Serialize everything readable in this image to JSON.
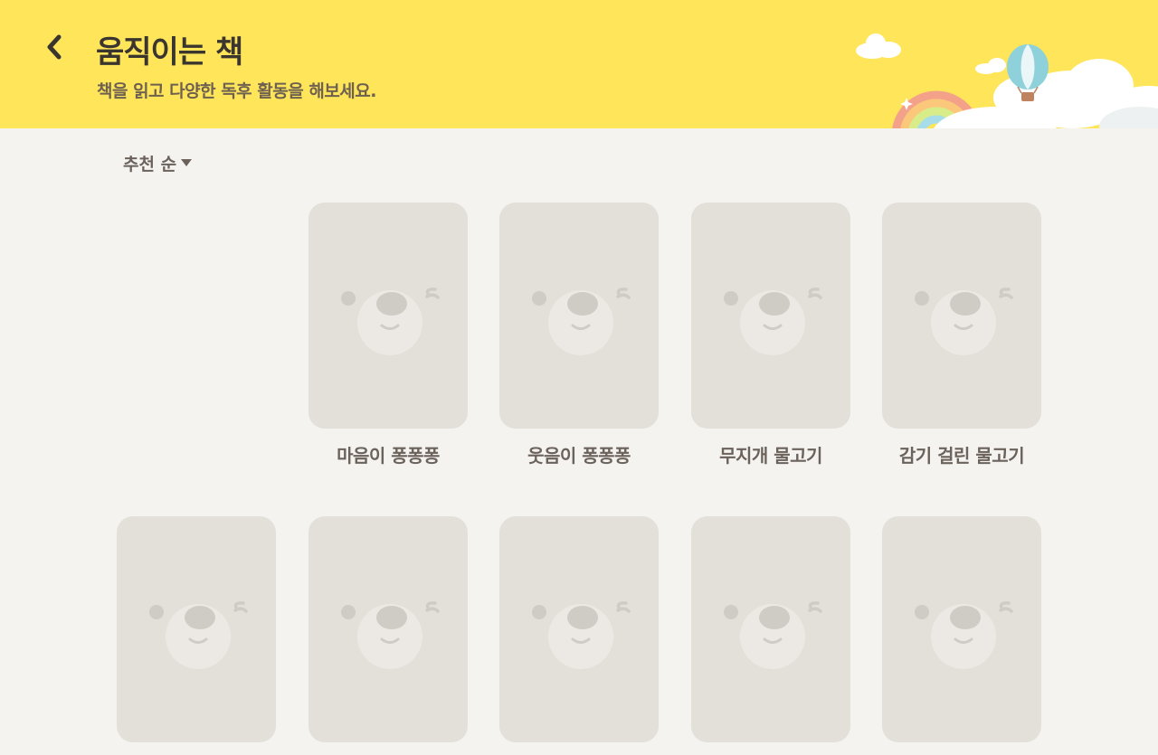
{
  "header": {
    "title": "움직이는 책",
    "subtitle": "책을 읽고 다양한 독후 활동을 해보세요."
  },
  "sort": {
    "label": "추천 순"
  },
  "books": [
    {
      "title": "마음이 퐁퐁퐁"
    },
    {
      "title": "웃음이 퐁퐁퐁"
    },
    {
      "title": "무지개 물고기"
    },
    {
      "title": "감기 걸린 물고기"
    },
    {
      "title": ""
    },
    {
      "title": ""
    },
    {
      "title": ""
    },
    {
      "title": ""
    },
    {
      "title": ""
    }
  ],
  "colors": {
    "header_bg": "#fee55a",
    "page_bg": "#f4f3f0",
    "card_bg": "#e3dfd9",
    "text_dark": "#3b3530",
    "text_muted": "#6b625b"
  },
  "icons": {
    "back": "chevron-left-icon",
    "sort": "caret-down-icon",
    "placeholder": "bear-face-placeholder-icon"
  }
}
